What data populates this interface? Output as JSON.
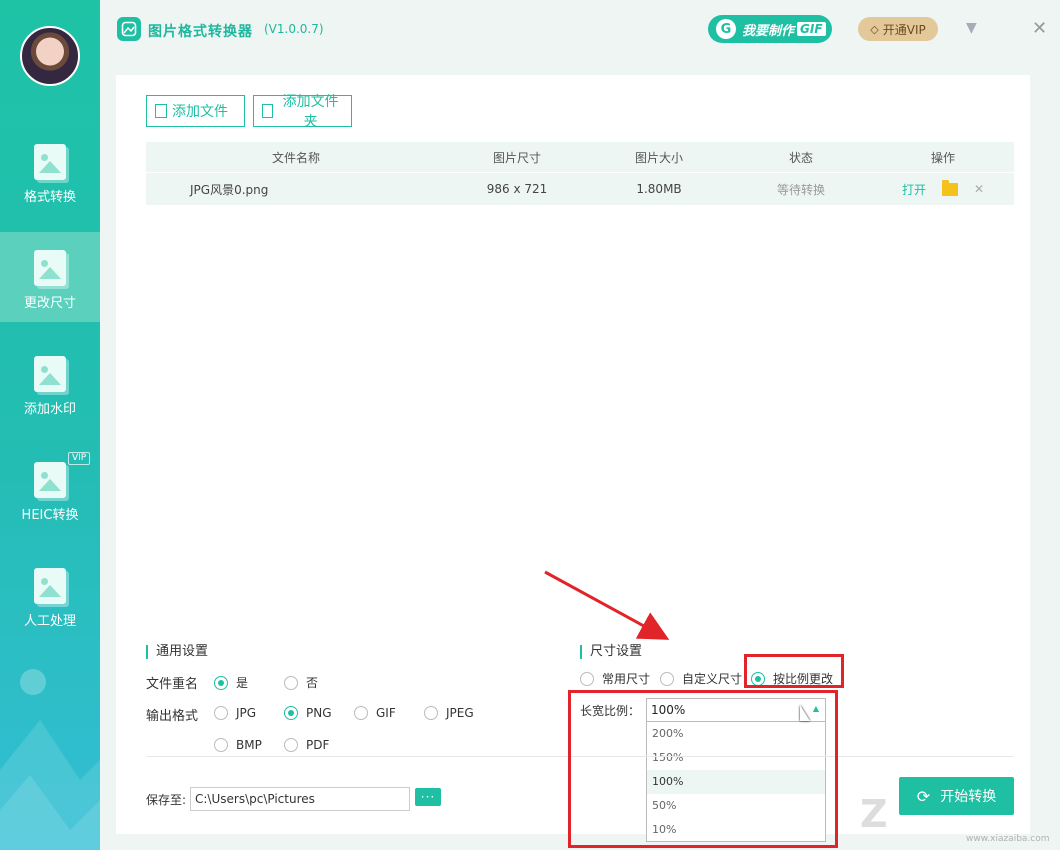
{
  "sidebar": {
    "items": [
      {
        "label": "格式转换",
        "icon": "image-convert-icon"
      },
      {
        "label": "更改尺寸",
        "icon": "image-resize-icon"
      },
      {
        "label": "添加水印",
        "icon": "image-watermark-icon"
      },
      {
        "label": "HEIC转换",
        "icon": "heic-icon"
      },
      {
        "label": "人工处理",
        "icon": "manual-process-icon"
      }
    ],
    "vip_tag": "VIP",
    "active_index": 1
  },
  "header": {
    "title": "图片格式转换器",
    "version": "(V1.0.0.7)",
    "gif_button": {
      "g": "G",
      "text": "我要制作",
      "gif": "GIF"
    },
    "vip_button": "开通VIP"
  },
  "toolbar": {
    "add_file": "添加文件",
    "add_folder": "添加文件夹"
  },
  "table": {
    "headers": [
      "文件名称",
      "图片尺寸",
      "图片大小",
      "状态",
      "操作"
    ],
    "rows": [
      {
        "name": "JPG风景0.png",
        "size": "986 x 721",
        "filesize": "1.80MB",
        "status": "等待转换",
        "open": "打开"
      }
    ]
  },
  "general": {
    "title": "通用设置",
    "rename_label": "文件重名",
    "rename_options": [
      "是",
      "否"
    ],
    "rename_selected": 0,
    "format_label": "输出格式",
    "formats": [
      "JPG",
      "PNG",
      "GIF",
      "JPEG",
      "BMP",
      "PDF"
    ],
    "format_selected": 1
  },
  "size_settings": {
    "title": "尺寸设置",
    "modes": [
      "常用尺寸",
      "自定义尺寸",
      "按比例更改"
    ],
    "mode_selected": 2,
    "ratio_label": "长宽比例：",
    "ratio_value": "100%",
    "ratio_options": [
      "200%",
      "150%",
      "100%",
      "50%",
      "10%"
    ],
    "ratio_selected": 2
  },
  "footer": {
    "save_label": "保存至:",
    "save_path": "C:\\Users\\pc\\Pictures",
    "browse": "···",
    "start": "开始转换"
  },
  "watermark": {
    "big": "Z",
    "small": "www.xiazaiba.com"
  },
  "colors": {
    "accent": "#1fbfa3",
    "highlight": "#e0242a",
    "vip": "#e3c89a"
  }
}
